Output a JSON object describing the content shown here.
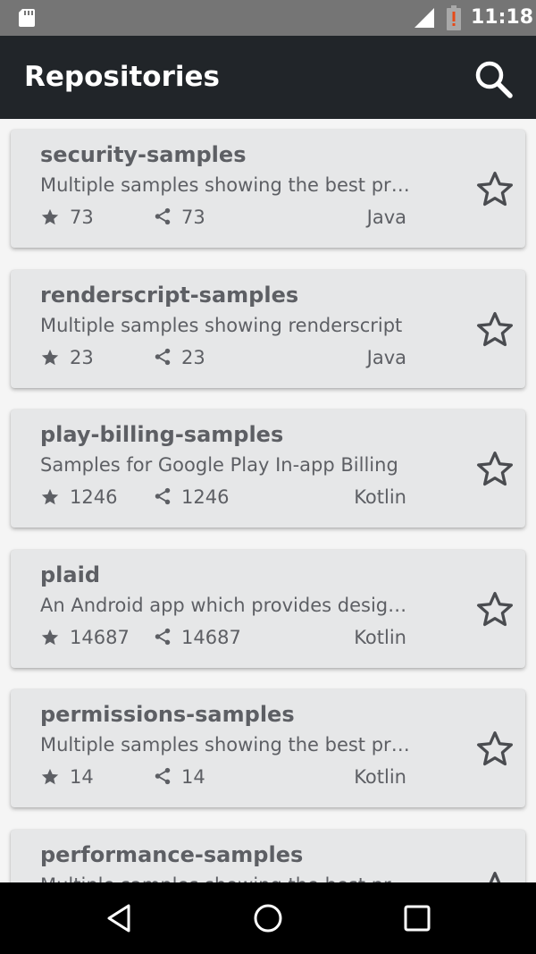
{
  "status_bar": {
    "time": "11:18",
    "icons": [
      "sd-card-icon",
      "signal-icon",
      "battery-alert-icon"
    ]
  },
  "app_bar": {
    "title": "Repositories",
    "icons": [
      "search-icon"
    ]
  },
  "repositories": [
    {
      "name": "security-samples",
      "description": "Multiple samples showing the best practices in security",
      "stars": "73",
      "forks": "73",
      "language": "Java"
    },
    {
      "name": "renderscript-samples",
      "description": "Multiple samples showing renderscript",
      "stars": "23",
      "forks": "23",
      "language": "Java"
    },
    {
      "name": "play-billing-samples",
      "description": "Samples for Google Play In-app Billing",
      "stars": "1246",
      "forks": "1246",
      "language": "Kotlin"
    },
    {
      "name": "plaid",
      "description": "An Android app which provides design news",
      "stars": "14687",
      "forks": "14687",
      "language": "Kotlin"
    },
    {
      "name": "permissions-samples",
      "description": "Multiple samples showing the best practices in permissions",
      "stars": "14",
      "forks": "14",
      "language": "Kotlin"
    },
    {
      "name": "performance-samples",
      "description": "Multiple samples showing the best practices",
      "stars": "",
      "forks": "",
      "language": ""
    }
  ],
  "nav_bar": {
    "icons": [
      "back-icon",
      "home-icon",
      "recents-icon"
    ]
  },
  "colors": {
    "status_bar": "#757575",
    "app_bar": "#212529",
    "card_background": "#e6e7e8",
    "card_text": "#5d5f64",
    "page_background": "#f5f5f5"
  }
}
